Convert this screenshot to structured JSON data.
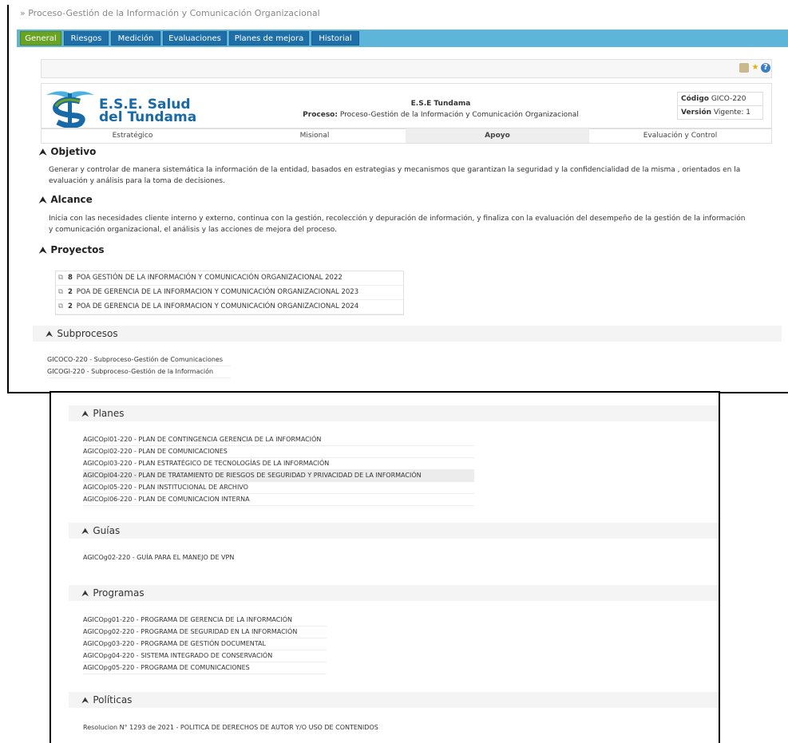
{
  "breadcrumb": "» Proceso-Gestión de la Información y Comunicación Organizacional",
  "tabs": [
    "General",
    "Riesgos",
    "Medición",
    "Evaluaciones",
    "Planes de mejora",
    "Historial"
  ],
  "logo": {
    "line1": "E.S.E. Salud",
    "line2": "del Tundama"
  },
  "company": {
    "name": "E.S.E Tundama",
    "process_label": "Proceso:",
    "process_value": "Proceso-Gestión de la Información y Comunicación Organizacional"
  },
  "code": {
    "code_label": "Código",
    "code_value": "GICO-220",
    "version_label": "Versión",
    "version_value": "Vigente: 1"
  },
  "map": [
    "Estratégico",
    "Misional",
    "Apoyo",
    "Evaluación y Control"
  ],
  "objetivo": {
    "title": "Objetivo",
    "line1": "Generar y controlar de manera sistemática la información de la entidad, basados en estrategias y mecanismos que garantizan la seguridad y la confidencialidad de la misma , orientados en la",
    "line2": "evaluación y análisis para la toma de decisiones."
  },
  "alcance": {
    "title": "Alcance",
    "line1": "Inicia con las necesidades cliente interno y externo, continua con la gestión, recolección y depuración de información, y finaliza con la evaluación del desempeño de la gestión de la información",
    "line2": "y comunicación organizacional, el análisis y las acciones de mejora del proceso."
  },
  "proyectos": {
    "title": "Proyectos",
    "rows": [
      {
        "count": "8",
        "name": "POA GESTIÓN DE LA INFORMACIÓN Y COMUNICACIÓN ORGANIZACIONAL 2022"
      },
      {
        "count": "2",
        "name": "POA DE GERENCIA DE LA INFORMACION Y COMUNICACIÓN ORGANIZACIONAL 2023"
      },
      {
        "count": "2",
        "name": "POA DE GERENCIA DE LA INFORMACION Y COMUNICACIÓN ORGANIZACIONAL 2024"
      }
    ]
  },
  "subprocesos": {
    "title": "Subprocesos",
    "items": [
      "GICOCO-220 - Subproceso-Gestión de Comunicaciones",
      "GICOGI-220 - Subproceso-Gestión de la Información"
    ]
  },
  "planes": {
    "title": "Planes",
    "items": [
      "AGICOpl01-220 - PLAN DE CONTINGENCIA GERENCIA DE LA INFORMACIÓN",
      "AGICOpl02-220 - PLAN DE COMUNICACIONES",
      "AGICOpl03-220 - PLAN ESTRATÉGICO DE TECNOLOGÍAS DE LA INFORMACIÓN",
      "AGICOpl04-220 - PLAN DE TRATAMIENTO DE RIESGOS DE SEGURIDAD Y PRIVACIDAD DE LA INFORMACIÓN",
      "AGICOpl05-220 - PLAN INSTITUCIONAL DE ARCHIVO",
      "AGICOpl06-220 - PLAN DE COMUNICACION INTERNA"
    ]
  },
  "guias": {
    "title": "Guías",
    "items": [
      "AGICOg02-220 - GUÍA PARA EL MANEJO DE VPN"
    ]
  },
  "programas": {
    "title": "Programas",
    "items": [
      "AGICOpg01-220 - PROGRAMA DE GERENCIA DE LA INFORMACIÓN",
      "AGICOpg02-220 - PROGRAMA DE SEGURIDAD EN LA INFORMACIÓN",
      "AGICOpg03-220 - PROGRAMA DE GESTIÓN DOCUMENTAL",
      "AGICOpg04-220 - SISTEMA INTEGRADO DE CONSERVACIÓN",
      "AGICOpg05-220 - PROGRAMA DE COMUNICACIONES"
    ]
  },
  "politicas": {
    "title": "Políticas",
    "items": [
      "Resolucion N° 1293 de 2021 - POLITICA DE DERECHOS DE AUTOR Y/O USO DE CONTENIDOS"
    ]
  },
  "colors": {
    "tab_active": "#6aa323",
    "tab": "#1e6fa8",
    "tabs_bar": "#5fb4d9",
    "logo_blue": "#1769a8",
    "logo_green": "#6aa323"
  }
}
